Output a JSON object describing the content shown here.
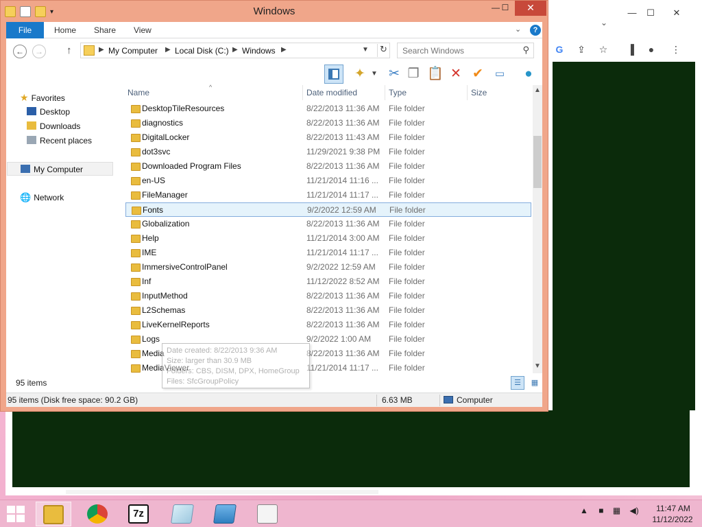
{
  "window": {
    "title": "Windows",
    "minimize": "—",
    "maximize": "☐",
    "close": "✕"
  },
  "ribbon": {
    "file": "File",
    "home": "Home",
    "share": "Share",
    "view": "View",
    "help": "?"
  },
  "address": {
    "crumbs": [
      "My Computer",
      "Local Disk (C:)",
      "Windows"
    ],
    "search_placeholder": "Search Windows"
  },
  "navpane": {
    "favorites": "Favorites",
    "desktop": "Desktop",
    "downloads": "Downloads",
    "recent": "Recent places",
    "mycomputer": "My Computer",
    "network": "Network"
  },
  "columns": {
    "name": "Name",
    "date": "Date modified",
    "type": "Type",
    "size": "Size"
  },
  "files": [
    {
      "name": "DesktopTileResources",
      "date": "8/22/2013 11:36 AM",
      "type": "File folder"
    },
    {
      "name": "diagnostics",
      "date": "8/22/2013 11:36 AM",
      "type": "File folder"
    },
    {
      "name": "DigitalLocker",
      "date": "8/22/2013 11:43 AM",
      "type": "File folder"
    },
    {
      "name": "dot3svc",
      "date": "11/29/2021 9:38 PM",
      "type": "File folder"
    },
    {
      "name": "Downloaded Program Files",
      "date": "8/22/2013 11:36 AM",
      "type": "File folder"
    },
    {
      "name": "en-US",
      "date": "11/21/2014 11:16 ...",
      "type": "File folder"
    },
    {
      "name": "FileManager",
      "date": "11/21/2014 11:17 ...",
      "type": "File folder"
    },
    {
      "name": "Fonts",
      "date": "9/2/2022 12:59 AM",
      "type": "File folder",
      "selected": true
    },
    {
      "name": "Globalization",
      "date": "8/22/2013 11:36 AM",
      "type": "File folder"
    },
    {
      "name": "Help",
      "date": "11/21/2014 3:00 AM",
      "type": "File folder"
    },
    {
      "name": "IME",
      "date": "11/21/2014 11:17 ...",
      "type": "File folder"
    },
    {
      "name": "ImmersiveControlPanel",
      "date": "9/2/2022 12:59 AM",
      "type": "File folder"
    },
    {
      "name": "Inf",
      "date": "11/12/2022 8:52 AM",
      "type": "File folder"
    },
    {
      "name": "InputMethod",
      "date": "8/22/2013 11:36 AM",
      "type": "File folder"
    },
    {
      "name": "L2Schemas",
      "date": "8/22/2013 11:36 AM",
      "type": "File folder"
    },
    {
      "name": "LiveKernelReports",
      "date": "8/22/2013 11:36 AM",
      "type": "File folder"
    },
    {
      "name": "Logs",
      "date": "9/2/2022 1:00 AM",
      "type": "File folder"
    },
    {
      "name": "Media",
      "date": "8/22/2013 11:36 AM",
      "type": "File folder"
    },
    {
      "name": "MediaViewer",
      "date": "11/21/2014 11:17 ...",
      "type": "File folder"
    }
  ],
  "tooltip": {
    "line1": "Date created: 8/22/2013 9:36 AM",
    "line2": "Size: larger than 30.9 MB",
    "line3": "Folders: CBS, DISM, DPX, HomeGroup",
    "line4": "Files: SfcGroupPolicy"
  },
  "status": {
    "items_count": "95 items",
    "summary": "95 items (Disk free space: 90.2 GB)",
    "size": "6.63 MB",
    "location": "Computer"
  },
  "taskbar": {
    "time": "11:47 AM",
    "date": "11/12/2022",
    "zip_label": "7z"
  },
  "colors": {
    "window_frame": "#f0a68a",
    "accent": "#1979ca",
    "close_button": "#c7493a",
    "selection": "#e5f3fb",
    "desktop_dark": "#0b2b0b"
  }
}
